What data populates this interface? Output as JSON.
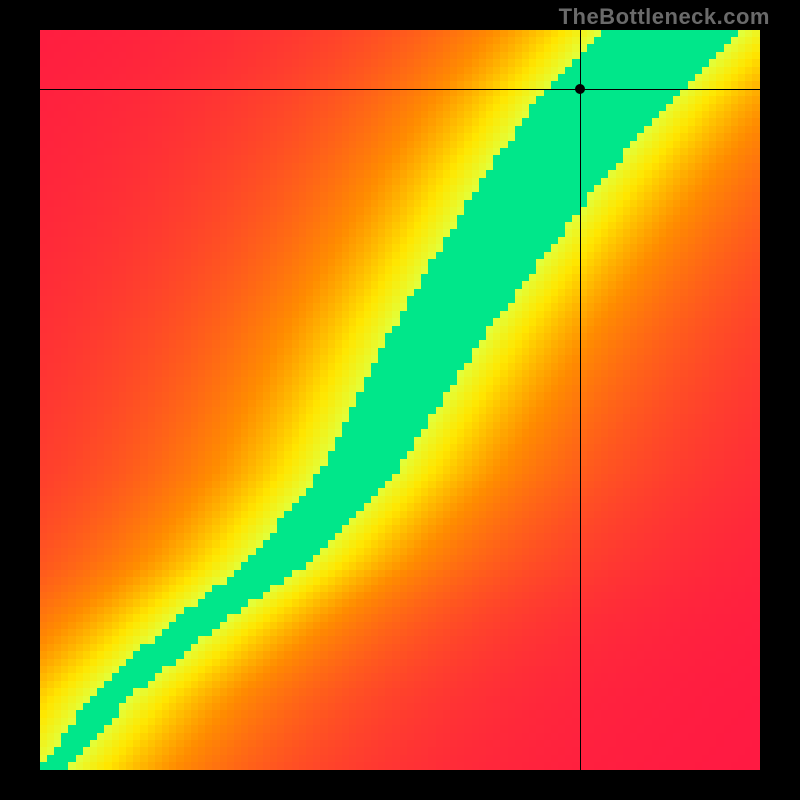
{
  "attribution": "TheBottleneck.com",
  "chart_data": {
    "type": "heatmap",
    "title": "",
    "xlabel": "",
    "ylabel": "",
    "xlim": [
      0,
      100
    ],
    "ylim": [
      0,
      100
    ],
    "crosshair": {
      "x": 75,
      "y": 92
    },
    "optimal_ridge": {
      "desc": "green/optimal band centerline, x as function of y, normalized 0-100",
      "points": [
        {
          "y": 0,
          "x": 2
        },
        {
          "y": 10,
          "x": 10
        },
        {
          "y": 20,
          "x": 22
        },
        {
          "y": 28,
          "x": 33
        },
        {
          "y": 40,
          "x": 44
        },
        {
          "y": 50,
          "x": 50
        },
        {
          "y": 60,
          "x": 56
        },
        {
          "y": 70,
          "x": 63
        },
        {
          "y": 80,
          "x": 70
        },
        {
          "y": 90,
          "x": 78
        },
        {
          "y": 100,
          "x": 88
        }
      ]
    },
    "color_scale": [
      {
        "stop": 0.0,
        "color": "#ff1744"
      },
      {
        "stop": 0.45,
        "color": "#ff8c00"
      },
      {
        "stop": 0.7,
        "color": "#ffe600"
      },
      {
        "stop": 0.88,
        "color": "#e2ff3a"
      },
      {
        "stop": 1.0,
        "color": "#00e78a"
      }
    ],
    "grid": false,
    "pixelation": 100
  }
}
